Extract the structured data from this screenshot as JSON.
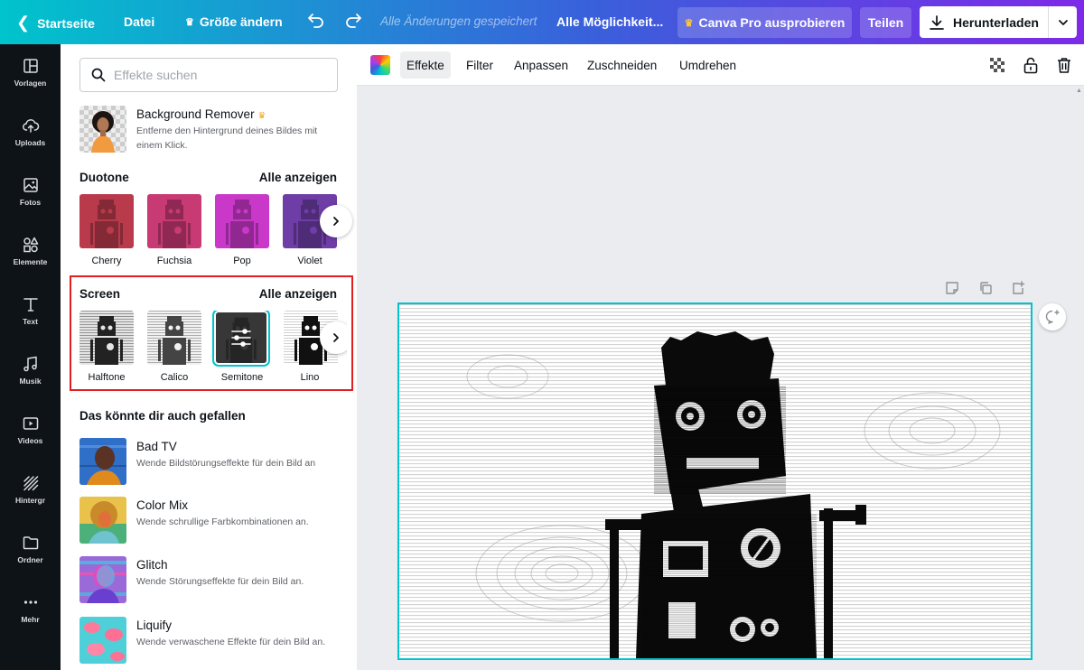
{
  "topbar": {
    "home": "Startseite",
    "file": "Datei",
    "resize": "Größe ändern",
    "saved_status": "Alle Änderungen gespeichert",
    "options": "Alle Möglichkeit...",
    "pro": "Canva Pro ausprobieren",
    "share": "Teilen",
    "download": "Herunterladen"
  },
  "rail": [
    {
      "label": "Vorlagen",
      "icon": "layout-icon"
    },
    {
      "label": "Uploads",
      "icon": "cloud-upload-icon"
    },
    {
      "label": "Fotos",
      "icon": "image-icon"
    },
    {
      "label": "Elemente",
      "icon": "shapes-icon"
    },
    {
      "label": "Text",
      "icon": "text-icon"
    },
    {
      "label": "Musik",
      "icon": "music-icon"
    },
    {
      "label": "Videos",
      "icon": "video-icon"
    },
    {
      "label": "Hintergr",
      "icon": "background-icon"
    },
    {
      "label": "Ordner",
      "icon": "folder-icon"
    },
    {
      "label": "Mehr",
      "icon": "more-icon"
    }
  ],
  "panel": {
    "search_placeholder": "Effekte suchen",
    "bg_remover": {
      "title": "Background Remover",
      "desc": "Entferne den Hintergrund deines Bildes mit einem Klick."
    },
    "duotone": {
      "title": "Duotone",
      "see_all": "Alle anzeigen",
      "items": [
        "Cherry",
        "Fuchsia",
        "Pop",
        "Violet"
      ],
      "colors": [
        "#b83a4b",
        "#c73a74",
        "#c938c9",
        "#6e3da6"
      ]
    },
    "screen": {
      "title": "Screen",
      "see_all": "Alle anzeigen",
      "items": [
        "Halftone",
        "Calico",
        "Semitone",
        "Lino"
      ],
      "selected": "Semitone"
    },
    "recommended": {
      "title": "Das könnte dir auch gefallen",
      "items": [
        {
          "title": "Bad TV",
          "desc": "Wende Bildstörungseffekte für dein Bild an"
        },
        {
          "title": "Color Mix",
          "desc": "Wende schrullige Farbkombinationen an."
        },
        {
          "title": "Glitch",
          "desc": "Wende Störungseffekte für dein Bild an."
        },
        {
          "title": "Liquify",
          "desc": "Wende verwaschene Effekte für dein Bild an."
        }
      ]
    }
  },
  "toolbar": {
    "effects": "Effekte",
    "filter": "Filter",
    "adjust": "Anpassen",
    "crop": "Zuschneiden",
    "flip": "Umdrehen"
  },
  "colors": {
    "accent": "#00c4cc",
    "highlight_box": "#e02020",
    "purple": "#7d2ae8"
  }
}
